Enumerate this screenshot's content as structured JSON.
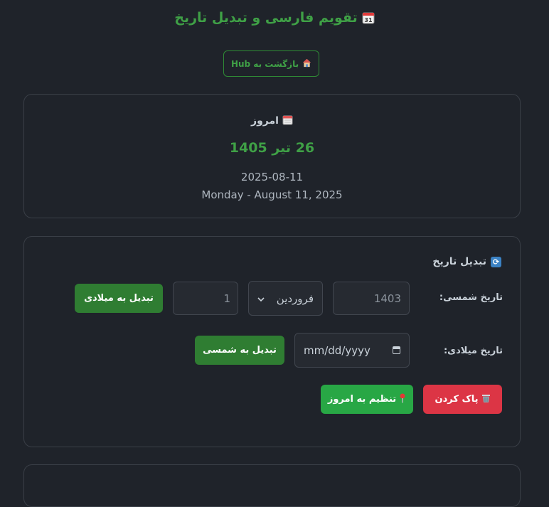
{
  "header": {
    "title": "تقویم فارسی و تبدیل تاریخ",
    "title_icon": "calendar-31-icon",
    "hub_button_label": "بازگشت به Hub",
    "hub_icon": "house-icon"
  },
  "today": {
    "heading": "امروز",
    "heading_icon": "calendar-icon",
    "persian_date": "26 تیر 1405",
    "iso_date": "2025-08-11",
    "long_date": "Monday - August 11, 2025"
  },
  "converter": {
    "heading": "تبدیل تاریخ",
    "heading_icon": "sync-icon",
    "shamsi_label": "تاریخ شمسی:",
    "year_placeholder": "1403",
    "month_value": "فروردین",
    "day_placeholder": "1",
    "to_gregorian_label": "تبدیل به میلادی",
    "gregorian_label": "تاریخ میلادی:",
    "gregorian_placeholder": "mm/dd/yyyy",
    "to_shamsi_label": "تبدیل به شمسی",
    "clear_label": "پاک کردن",
    "clear_icon": "trash-icon",
    "set_today_label": "تنظیم به امروز",
    "set_today_icon": "pin-icon"
  },
  "colors": {
    "accent_green": "#3fa046",
    "button_green": "#28a745",
    "button_dark_green": "#2f7d32",
    "button_red": "#dc3545",
    "background": "#1f232a"
  }
}
